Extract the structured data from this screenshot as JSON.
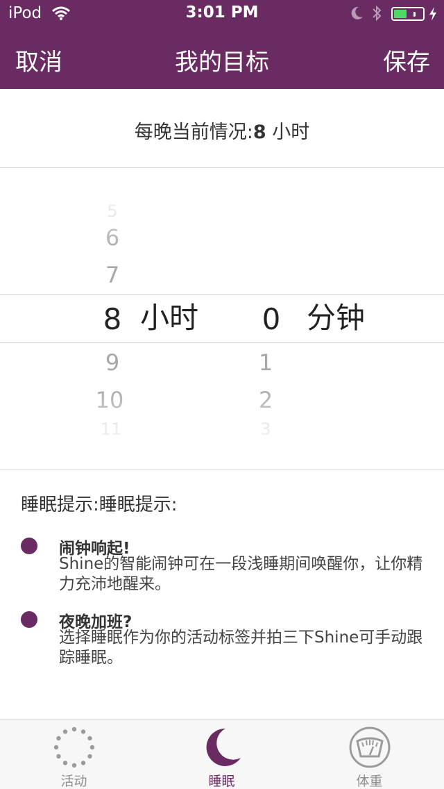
{
  "status_bar": {
    "carrier": "iPod",
    "time": "3:01 PM",
    "icons": [
      "wifi-icon",
      "moon-icon",
      "bluetooth-icon",
      "battery-icon",
      "charging-bolt-icon"
    ],
    "battery_level": 0.45
  },
  "nav": {
    "cancel_label": "取消",
    "title": "我的目标",
    "save_label": "保存"
  },
  "current": {
    "prefix": "每晚当前情况:",
    "value": "8",
    "suffix": " 小时"
  },
  "picker": {
    "hours_above": [
      "5",
      "6",
      "7"
    ],
    "hours_selected": "8",
    "hours_unit": "小时",
    "hours_below": [
      "9",
      "10",
      "11"
    ],
    "minutes_selected": "0",
    "minutes_unit": "分钟",
    "minutes_below": [
      "1",
      "2",
      "3"
    ]
  },
  "tips": {
    "heading": "睡眠提示:睡眠提示:",
    "items": [
      {
        "title": "闹钟响起!",
        "description": "Shine的智能闹钟可在一段浅睡期间唤醒你，让你精力充沛地醒来。"
      },
      {
        "title": "夜晚加班?",
        "description": "选择睡眠作为你的活动标签并拍三下Shine可手动跟踪睡眠。"
      }
    ]
  },
  "tabbar": {
    "tabs": [
      {
        "label": "活动",
        "icon": "activity-dots-icon",
        "active": false
      },
      {
        "label": "睡眠",
        "icon": "moon-icon",
        "active": true
      },
      {
        "label": "体重",
        "icon": "scale-icon",
        "active": false
      }
    ]
  },
  "colors": {
    "brand": "#6a2a62",
    "battery_green": "#4cd964"
  }
}
